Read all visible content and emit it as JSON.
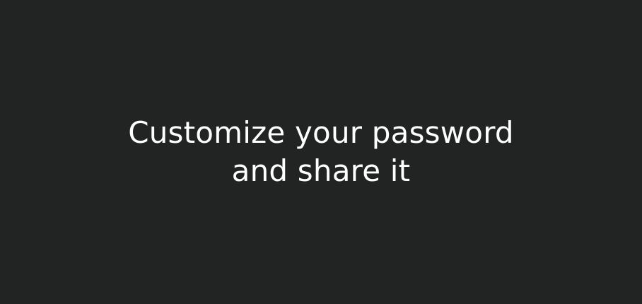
{
  "screen": {
    "background_color": "#222423",
    "text_color": "#ffffff",
    "headline": {
      "line1": "Customize your password",
      "line2": "and share it"
    }
  }
}
